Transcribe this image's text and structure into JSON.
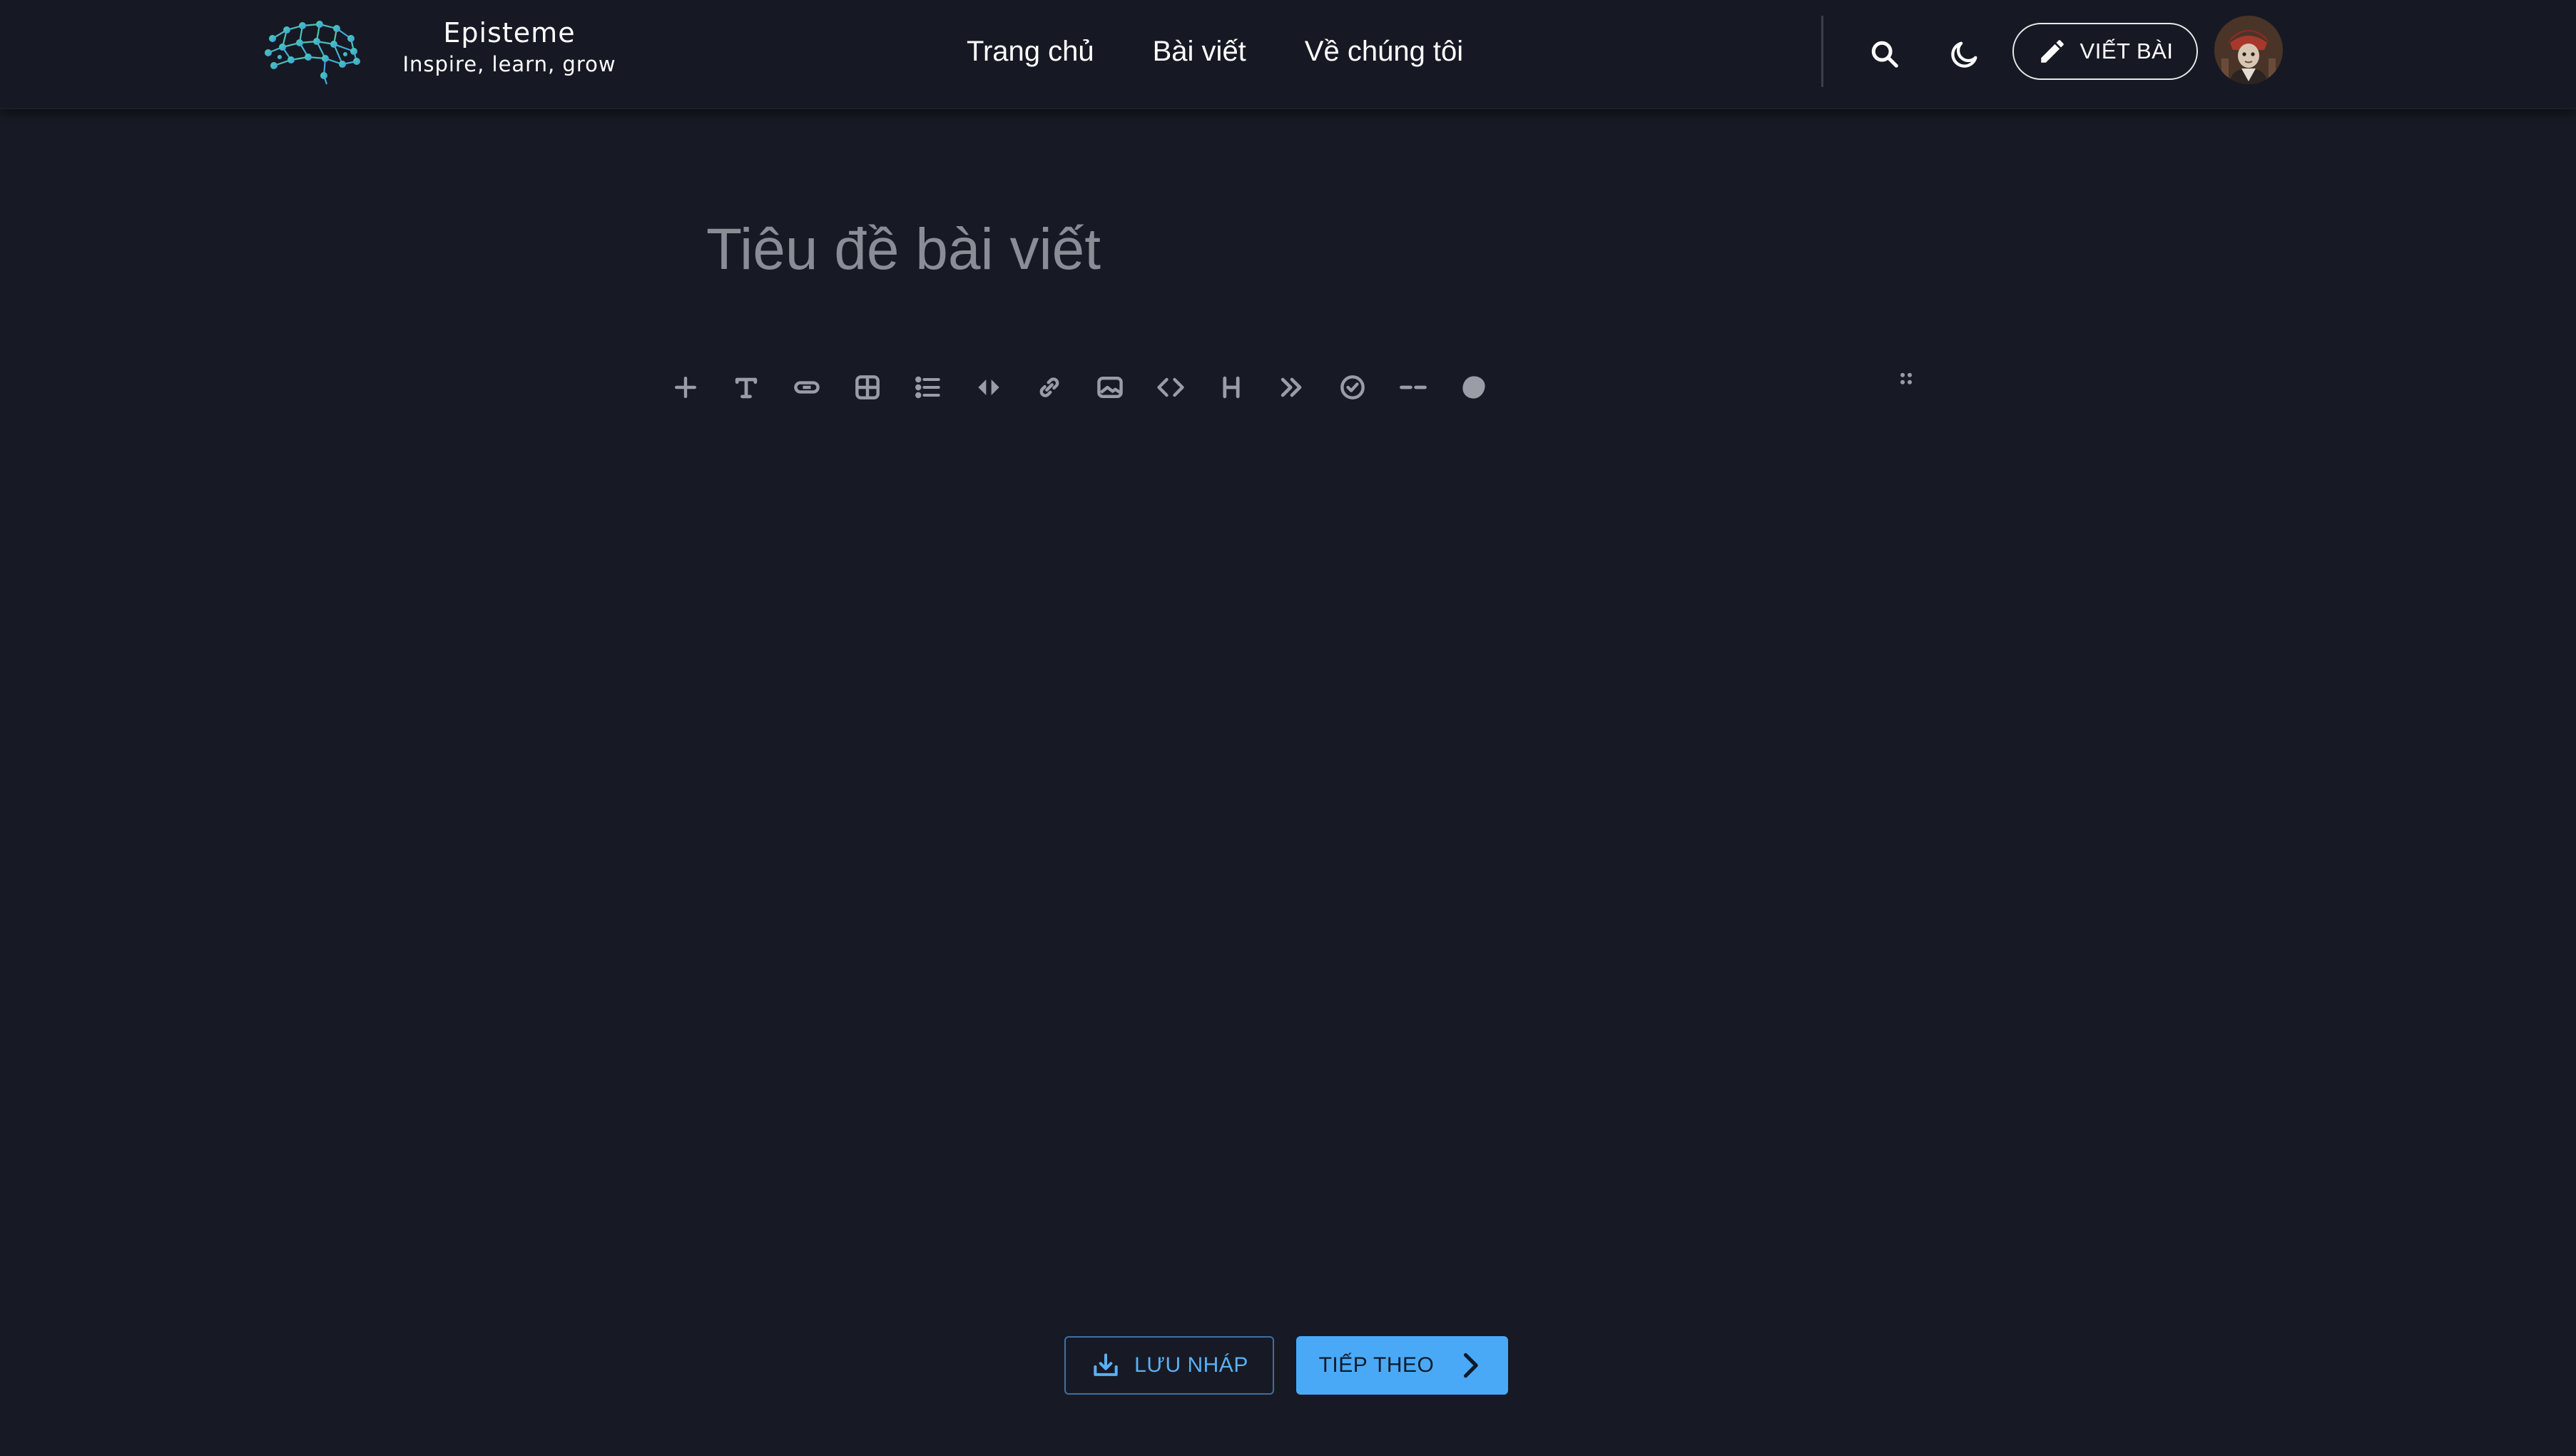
{
  "header": {
    "brand_name": "Episteme",
    "brand_tagline": "Inspire, learn, grow",
    "nav": [
      {
        "label": "Trang chủ"
      },
      {
        "label": "Bài viết"
      },
      {
        "label": "Về chúng tôi"
      }
    ],
    "search_icon": "search-icon",
    "theme_icon": "moon-icon",
    "write_label": "VIẾT BÀI",
    "write_icon": "pencil-icon"
  },
  "editor": {
    "title_placeholder": "Tiêu đề bài viết",
    "toolbar": [
      "plus-icon",
      "text-icon",
      "pill-icon",
      "table-icon",
      "list-icon",
      "code-inline-icon",
      "link-icon",
      "image-icon",
      "code-block-icon",
      "heading-icon",
      "quote-icon",
      "checklist-icon",
      "delimiter-icon",
      "blob-icon"
    ]
  },
  "actions": {
    "save_draft_label": "LƯU NHÁP",
    "next_label": "TIẾP THEO"
  },
  "colors": {
    "background": "#171a24",
    "accent": "#4aa9f7",
    "draft_text": "#5ab0f5",
    "toolbar_icon": "#9a9da6"
  }
}
